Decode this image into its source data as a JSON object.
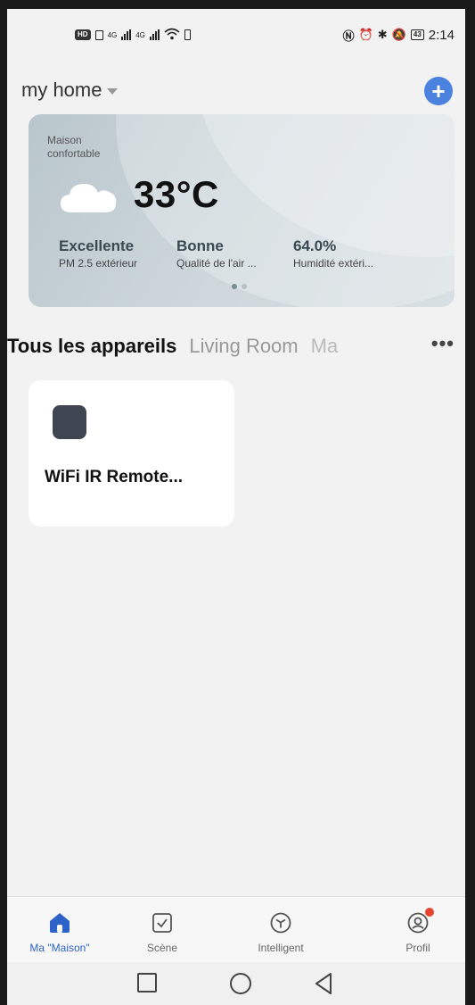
{
  "status_bar": {
    "left_chip": "HD",
    "signal_1_label": "4G",
    "signal_2_label": "4G",
    "battery": "43",
    "time": "2:14"
  },
  "header": {
    "home_name": "my home",
    "add_icon": "plus-circle-icon"
  },
  "weather": {
    "label": "Maison confortable",
    "icon": "cloud-icon",
    "temperature": "33°C",
    "metrics": [
      {
        "value": "Excellente",
        "label": "PM 2.5 extérieur"
      },
      {
        "value": "Bonne",
        "label": "Qualité de l'air ..."
      },
      {
        "value": "64.0%",
        "label": "Humidité extéri..."
      }
    ],
    "page_index": 1,
    "page_count": 2
  },
  "tabs": {
    "items": [
      "Tous les appareils",
      "Living Room",
      "Ma"
    ],
    "active_index": 0,
    "more_label": "•••"
  },
  "devices": [
    {
      "name": "WiFi IR Remote...",
      "icon": "ir-remote-icon"
    }
  ],
  "bottom_nav": {
    "items": [
      {
        "label": "Ma \"Maison\"",
        "icon": "home-icon",
        "active": true
      },
      {
        "label": "Scène",
        "icon": "checkbox-icon",
        "active": false
      },
      {
        "label": "Intelligent",
        "icon": "cube-icon",
        "active": false
      },
      {
        "label": "Profil",
        "icon": "profile-icon",
        "active": false,
        "badge": true
      }
    ]
  },
  "system_nav": [
    "recent-apps-icon",
    "home-circle-icon",
    "back-triangle-icon"
  ],
  "colors": {
    "accent": "#4b82e0",
    "active_nav": "#2d63c8",
    "badge": "#e8412f",
    "device_icon": "#3f4651"
  }
}
